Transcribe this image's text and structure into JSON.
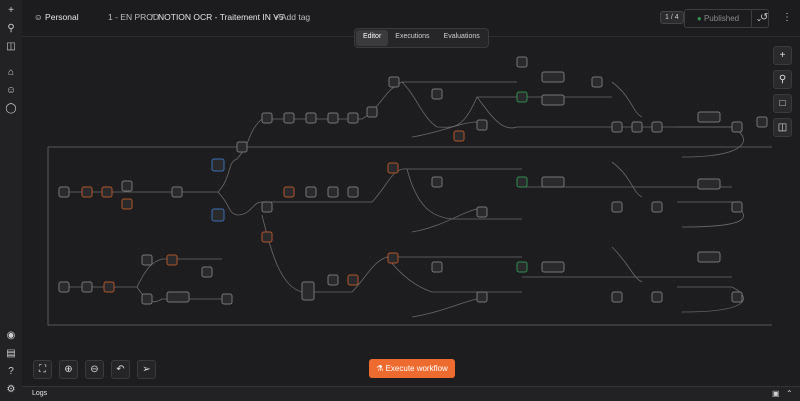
{
  "header": {
    "project": "Personal",
    "folder": "1 - EN PROD",
    "workflow_name": "NOTION OCR - Traitement IN V5",
    "add_tag": "+ Add tag",
    "version_badge": "1 / 4",
    "publish_status": "Published"
  },
  "tabs": [
    {
      "label": "Editor",
      "active": true
    },
    {
      "label": "Executions",
      "active": false
    },
    {
      "label": "Evaluations",
      "active": false
    }
  ],
  "actions": {
    "execute": "Execute workflow"
  },
  "logs": {
    "label": "Logs"
  },
  "colors": {
    "accent": "#ee6b2f",
    "node_orange": "#b2552a",
    "node_green": "#2f8f4e",
    "node_blue": "#3b6fb6"
  },
  "icons": {
    "left_rail": [
      "plus-icon",
      "search-icon",
      "sidebar-icon",
      "home-icon",
      "user-icon",
      "chat-icon",
      "templates-icon",
      "insights-icon",
      "help-icon",
      "settings-icon"
    ],
    "right_tools": [
      "add-node-icon",
      "zoom-search-icon",
      "sticky-note-icon",
      "panel-icon"
    ],
    "zoom_tools": [
      "fit-view-icon",
      "zoom-in-icon",
      "zoom-out-icon",
      "undo-icon",
      "select-tool-icon"
    ]
  }
}
